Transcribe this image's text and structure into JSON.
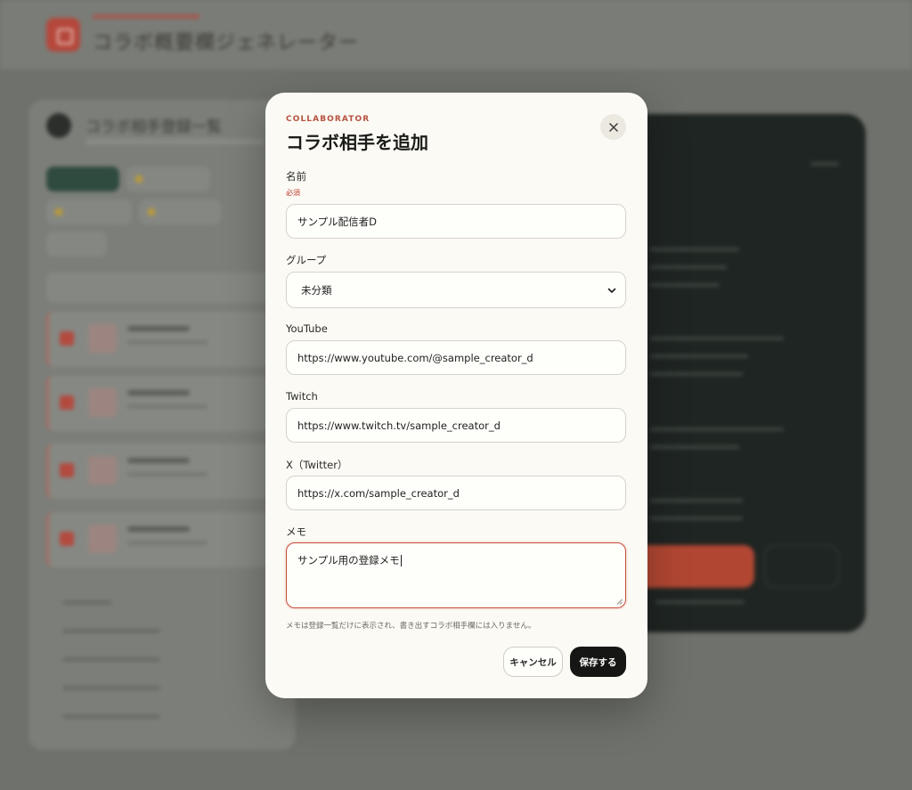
{
  "background": {
    "app_title": "コラボ概要欄ジェネレーター",
    "section_title": "コラボ相手登録一覧"
  },
  "modal": {
    "kicker": "COLLABORATOR",
    "title": "コラボ相手を追加",
    "close_icon": "close-icon",
    "fields": {
      "name": {
        "label": "名前",
        "required": "必須",
        "value": "サンプル配信者D"
      },
      "group": {
        "label": "グループ",
        "selected": "未分類"
      },
      "youtube": {
        "label": "YouTube",
        "value": "https://www.youtube.com/@sample_creator_d"
      },
      "twitch": {
        "label": "Twitch",
        "value": "https://www.twitch.tv/sample_creator_d"
      },
      "x": {
        "label": "X（Twitter）",
        "value": "https://x.com/sample_creator_d"
      },
      "memo": {
        "label": "メモ",
        "value": "サンプル用の登録メモ"
      }
    },
    "hint": "メモは登録一覧だけに表示され、書き出すコラボ相手欄には入りません。",
    "buttons": {
      "cancel": "キャンセル",
      "save": "保存する"
    }
  },
  "colors": {
    "accent": "#c94a3a",
    "kicker": "#b6513f",
    "primary_button": "#161614",
    "modal_bg": "#fbfaf4"
  }
}
